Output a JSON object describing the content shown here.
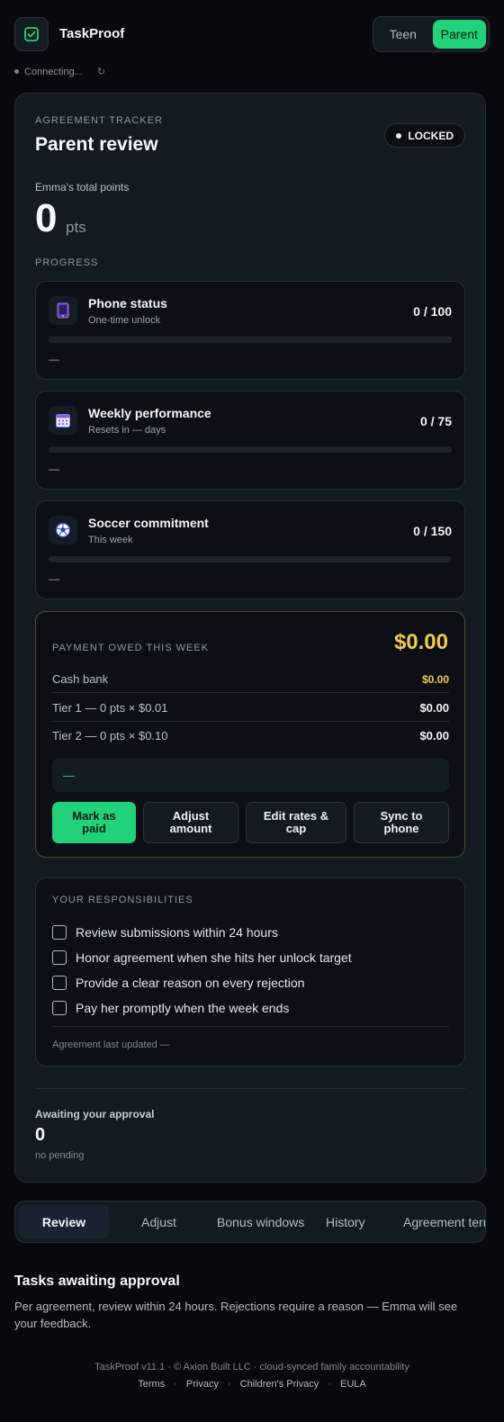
{
  "app": {
    "title": "TaskProof",
    "accent": "#22d27a",
    "gold": "#f2c94c"
  },
  "mode_toggle": {
    "teen_label": "Teen",
    "parent_label": "Parent",
    "selected": "Parent"
  },
  "connection": {
    "status": "Connecting...",
    "refresh_glyph": "↻"
  },
  "tracker": {
    "eyebrow": "AGREEMENT TRACKER",
    "title": "Parent review",
    "lock_status": "LOCKED",
    "points_label": "Emma's total points",
    "points_value": "0",
    "points_unit": "pts",
    "progress_label": "PROGRESS"
  },
  "progress_items": [
    {
      "icon": "phone-icon",
      "name": "Phone status",
      "subtitle": "One-time unlock",
      "value": "0 / 100",
      "fraction": 0,
      "note": "—"
    },
    {
      "icon": "calendar-icon",
      "name": "Weekly performance",
      "subtitle": "Resets in — days",
      "value": "0 / 75",
      "fraction": 0,
      "note": "—"
    },
    {
      "icon": "soccer-ball-icon",
      "name": "Soccer commitment",
      "subtitle": "This week",
      "value": "0 / 150",
      "fraction": 0,
      "note": "—"
    }
  ],
  "payment": {
    "eyebrow": "PAYMENT OWED THIS WEEK",
    "total": "$0.00",
    "rows": [
      {
        "label": "Cash bank",
        "value": "$0.00"
      },
      {
        "label": "Tier 1 — 0 pts × $0.01",
        "value": "$0.00"
      },
      {
        "label": "Tier 2 — 0 pts × $0.10",
        "value": "$0.00"
      }
    ],
    "note": "—",
    "buttons": {
      "mark_paid": "Mark as paid",
      "adjust": "Adjust amount",
      "edit_rates": "Edit rates & cap",
      "sync": "Sync to phone"
    }
  },
  "responsibilities": {
    "eyebrow": "YOUR RESPONSIBILITIES",
    "items": [
      "Review submissions within 24 hours",
      "Honor agreement when she hits her unlock target",
      "Provide a clear reason on every rejection",
      "Pay her promptly when the week ends"
    ],
    "updated": "Agreement last updated —"
  },
  "awaiting": {
    "label": "Awaiting your approval",
    "count": "0",
    "sub": "no pending"
  },
  "tabs": [
    "Review",
    "Adjust",
    "Bonus windows",
    "History",
    "Agreement terms"
  ],
  "section": {
    "title": "Tasks awaiting approval",
    "description": "Per agreement, review within 24 hours. Rejections require a reason — Emma will see your feedback."
  },
  "footer": {
    "line": "TaskProof v11.1 · © Axion Built LLC · cloud-synced family accountability",
    "links": [
      "Terms",
      "Privacy",
      "Children's Privacy",
      "EULA"
    ]
  }
}
